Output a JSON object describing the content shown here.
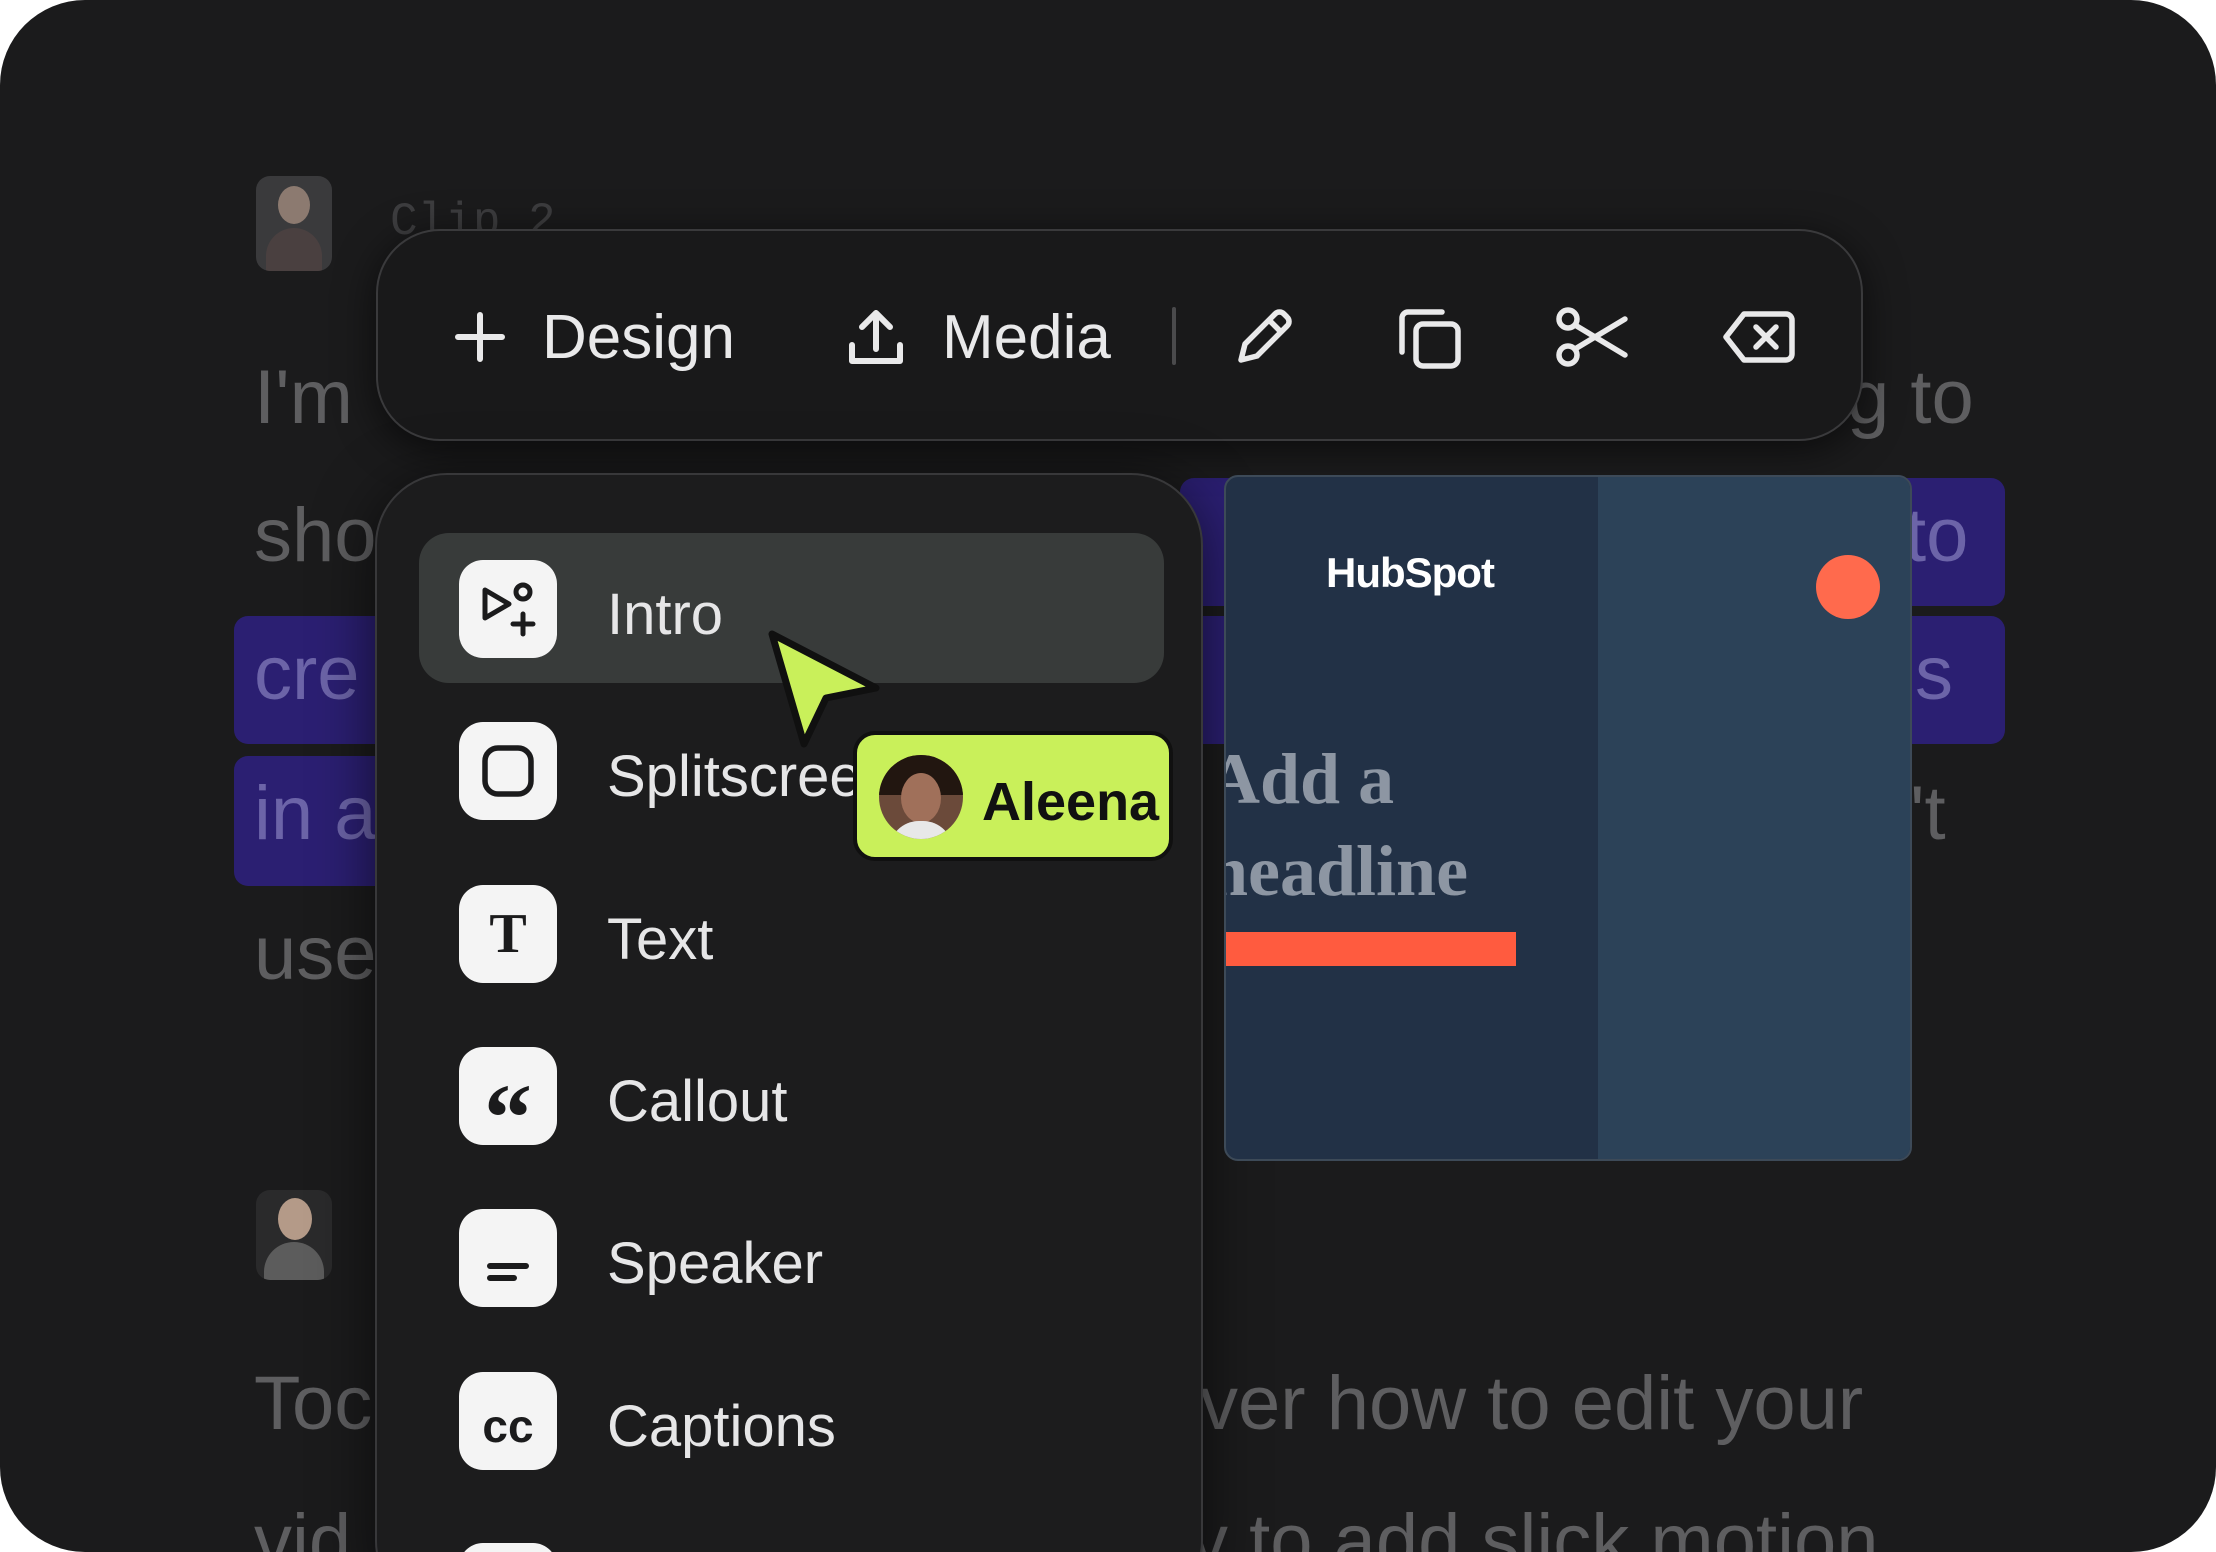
{
  "background": {
    "clip_label": "Clip 2",
    "lines": [
      {
        "left": "I'm",
        "right": "g to"
      },
      {
        "left": "sho",
        "right": "to"
      },
      {
        "left": "cre",
        "right": "s"
      },
      {
        "left": "in a",
        "right": "'t"
      },
      {
        "left": "use",
        "right": ""
      },
      {
        "left": "Toc",
        "right": "ver how to edit your"
      },
      {
        "left": "vid",
        "right": "v to add slick motion"
      }
    ]
  },
  "toolbar": {
    "design_label": "Design",
    "media_label": "Media",
    "edit_icon": "pencil-icon",
    "duplicate_icon": "duplicate-icon",
    "cut_icon": "scissors-icon",
    "delete_icon": "backspace-icon"
  },
  "menu": {
    "items": [
      {
        "label": "Intro",
        "icon": "intro-icon",
        "active": true
      },
      {
        "label": "Splitscreen",
        "icon": "splitscreen-icon"
      },
      {
        "label": "Text",
        "icon": "text-icon",
        "glyph": "T"
      },
      {
        "label": "Callout",
        "icon": "quote-icon",
        "glyph": "“"
      },
      {
        "label": "Speaker",
        "icon": "speaker-icon"
      },
      {
        "label": "Captions",
        "icon": "captions-icon",
        "glyph": "cc"
      }
    ]
  },
  "preview": {
    "logo": "HubSpot",
    "headline_line1": "Add a",
    "headline_line2": "headline",
    "accent_color": "#ff5b3f"
  },
  "collaborator": {
    "name": "Aleena",
    "tag_color": "#c9f05a"
  }
}
